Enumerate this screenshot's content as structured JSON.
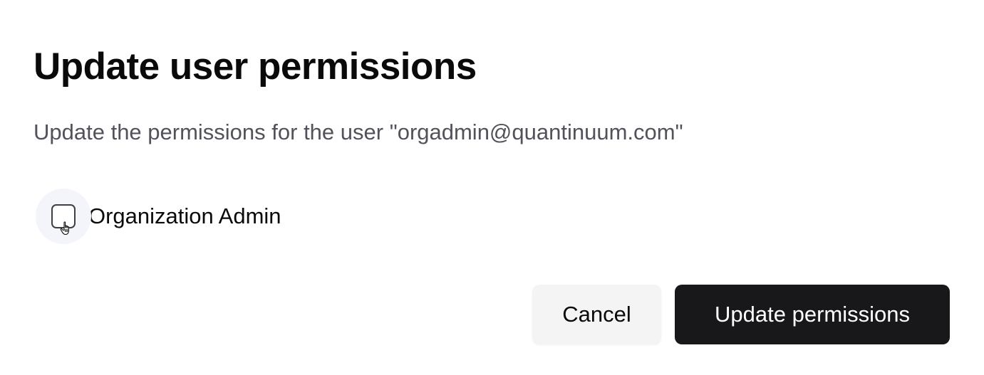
{
  "dialog": {
    "title": "Update user permissions",
    "description": "Update the permissions for the user \"orgadmin@quantinuum.com\"",
    "permissions": [
      {
        "label": "Organization Admin",
        "checked": false
      }
    ],
    "cursor_icon": "hand-pointer-icon",
    "actions": {
      "cancel_label": "Cancel",
      "submit_label": "Update permissions"
    }
  },
  "colors": {
    "primary_button_bg": "#18181b",
    "secondary_button_bg": "#f4f4f5",
    "description_text": "#52525b"
  }
}
